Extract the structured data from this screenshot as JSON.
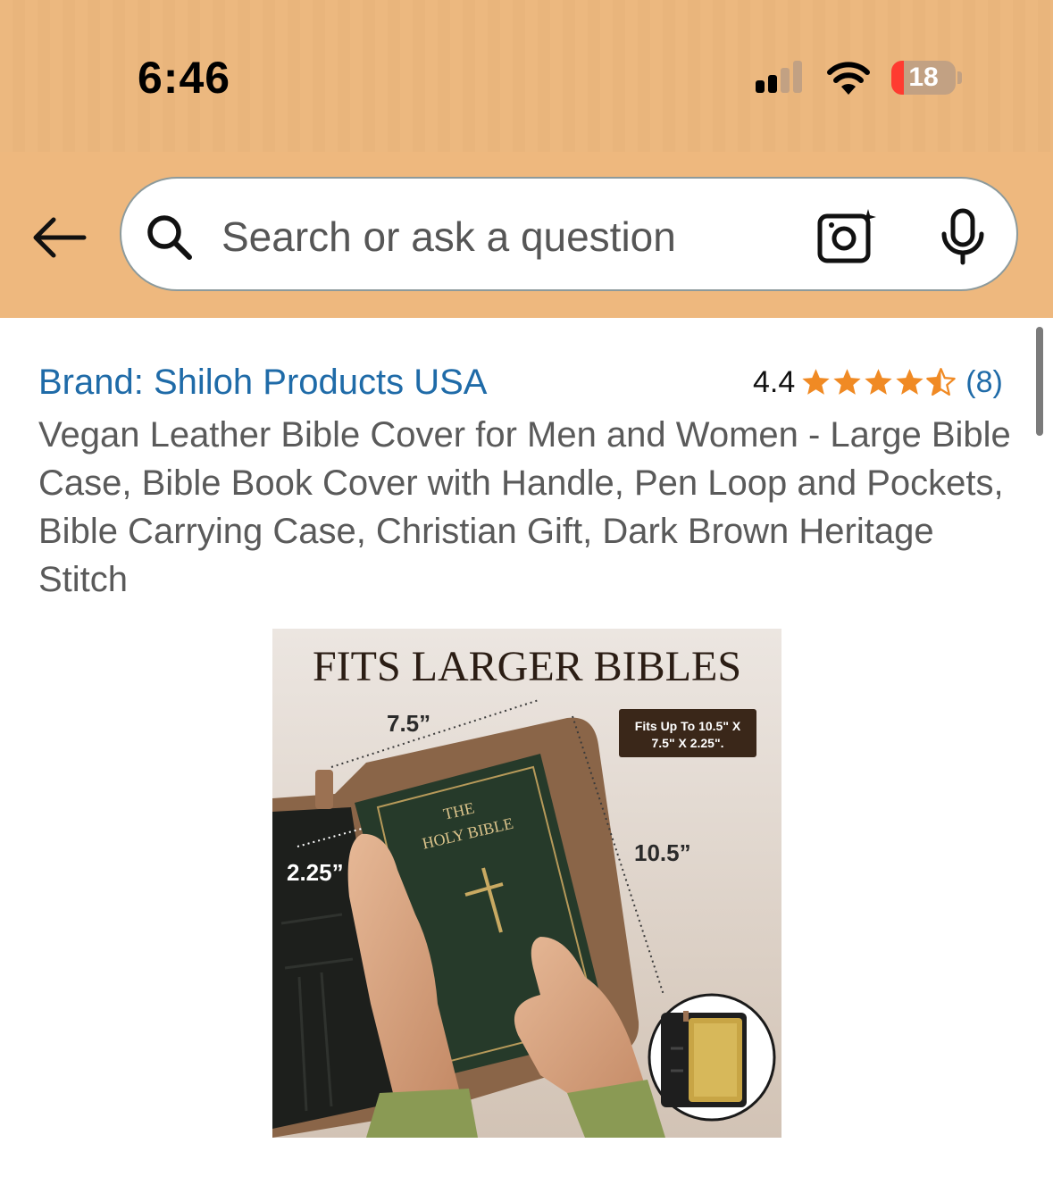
{
  "status_bar": {
    "time": "6:46",
    "battery_percent": "18"
  },
  "search": {
    "placeholder": "Search or ask a question"
  },
  "product": {
    "brand": "Brand: Shiloh Products USA",
    "rating_value": "4.4",
    "rating_stars": 4.5,
    "rating_count": "(8)",
    "title": "Vegan Leather Bible Cover for Men and Women - Large Bible Case, Bible Book Cover with Handle, Pen Loop and Pockets, Bible Carrying Case, Christian Gift, Dark Brown Heritage Stitch"
  },
  "image": {
    "headline": "FITS LARGER BIBLES",
    "width_label": "7.5”",
    "height_label": "10.5”",
    "depth_label": "2.25”",
    "badge_line1": "Fits Up To 10.5\" X",
    "badge_line2": "7.5\" X 2.25\".",
    "book_title_line1": "THE",
    "book_title_line2": "HOLY BIBLE"
  },
  "colors": {
    "header_bg": "#eeb87e",
    "link": "#1f6ba8",
    "star": "#f08a24",
    "battery_low": "#ff3b30"
  }
}
